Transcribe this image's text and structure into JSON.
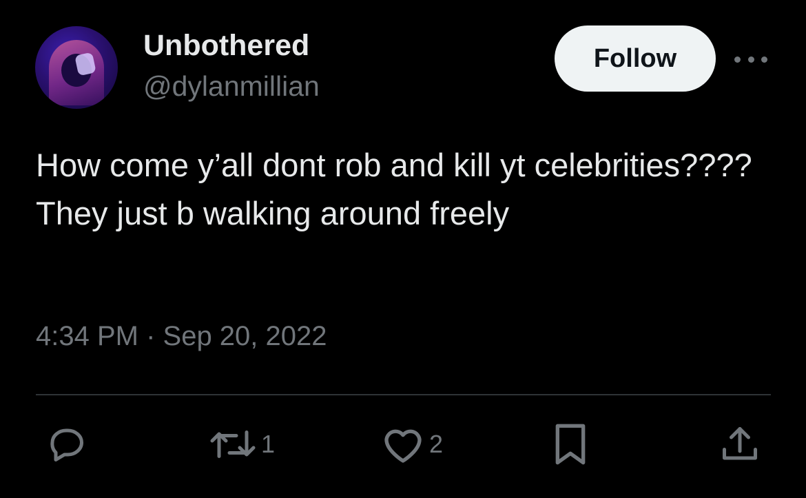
{
  "tweet": {
    "author": {
      "display_name": "Unbothered",
      "handle": "@dylanmillian"
    },
    "follow_label": "Follow",
    "text": "How come y’all dont rob and kill yt celebrities???? They just b walking around freely",
    "timestamp": "4:34 PM · Sep 20, 2022"
  },
  "actions": {
    "reply": {
      "icon": "reply-icon"
    },
    "retweet": {
      "icon": "retweet-icon",
      "count": "1"
    },
    "like": {
      "icon": "heart-icon",
      "count": "2"
    },
    "bookmark": {
      "icon": "bookmark-icon"
    },
    "share": {
      "icon": "share-icon"
    }
  },
  "colors": {
    "background": "#000000",
    "text_primary": "#e7e9ea",
    "text_secondary": "#71767b",
    "follow_bg": "#eff3f4",
    "divider": "#2f3336"
  }
}
